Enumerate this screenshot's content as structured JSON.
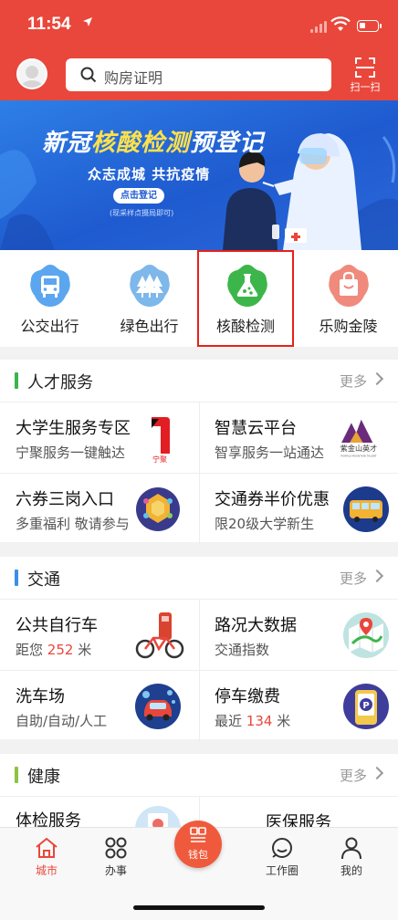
{
  "status": {
    "time": "11:54",
    "location_icon": "location-arrow-icon"
  },
  "header": {
    "search_placeholder": "购房证明",
    "scan_label": "扫一扫"
  },
  "banner": {
    "title_prefix": "新冠",
    "title_highlight": "核酸检测",
    "title_suffix": "预登记",
    "subtitle": "众志成城  共抗疫情",
    "button": "点击登记",
    "note": "(现采样点摄局即可)"
  },
  "quick_links": [
    {
      "label": "公交出行",
      "icon": "bus-icon"
    },
    {
      "label": "绿色出行",
      "icon": "trees-icon"
    },
    {
      "label": "核酸检测",
      "icon": "flask-icon"
    },
    {
      "label": "乐购金陵",
      "icon": "shopping-bag-icon"
    }
  ],
  "talent": {
    "title": "人才服务",
    "more": "更多",
    "cards": [
      {
        "title": "大学生服务专区",
        "desc": "宁聚服务一键触达",
        "logo_text": "宁聚"
      },
      {
        "title": "智慧云平台",
        "desc": "智享服务一站通达",
        "logo_text": "紫金山英才",
        "logo_sub": "PURPLE MOUNTAIN TALENT"
      },
      {
        "title": "六券三岗入口",
        "desc": "多重福利 敬请参与"
      },
      {
        "title": "交通券半价优惠",
        "desc": "限20级大学新生"
      }
    ]
  },
  "traffic": {
    "title": "交通",
    "more": "更多",
    "cards": [
      {
        "title": "公共自行车",
        "desc_prefix": "距您 ",
        "desc_num": "252",
        "desc_suffix": " 米"
      },
      {
        "title": "路况大数据",
        "desc": "交通指数"
      },
      {
        "title": "洗车场",
        "desc": "自助/自动/人工"
      },
      {
        "title": "停车缴费",
        "desc_prefix": "最近 ",
        "desc_num": "134",
        "desc_suffix": " 米"
      }
    ]
  },
  "health": {
    "title": "健康",
    "more": "更多",
    "cards": [
      {
        "title": "体检服务"
      },
      {
        "title": "医保服务"
      }
    ]
  },
  "tabbar": [
    {
      "label": "城市",
      "icon": "home-icon",
      "active": true
    },
    {
      "label": "办事",
      "icon": "grid-icon"
    },
    {
      "label": "钱包",
      "icon": "wallet-icon"
    },
    {
      "label": "工作圈",
      "icon": "chat-circle-icon"
    },
    {
      "label": "我的",
      "icon": "person-icon"
    }
  ],
  "colors": {
    "brand": "#e9473b",
    "banner": "#2563d8",
    "talent_bar": "#3ab54a",
    "traffic_bar": "#3b8fe8",
    "health_bar": "#8cc43f"
  }
}
